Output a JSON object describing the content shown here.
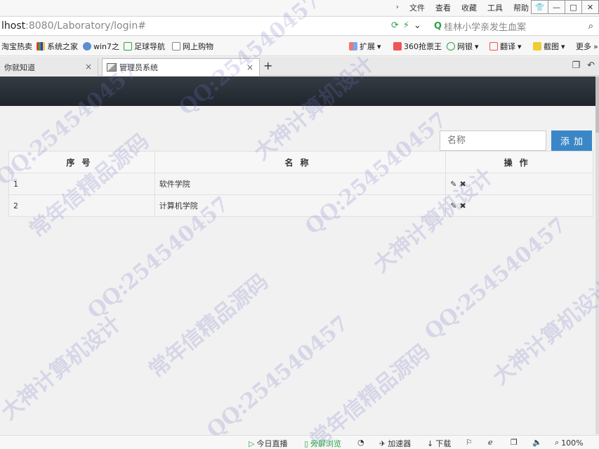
{
  "titlebar": {
    "menu": [
      "文件",
      "查看",
      "收藏",
      "工具",
      "帮助"
    ]
  },
  "address": {
    "host": "lhost",
    "rest": ":8080/Laboratory/login#",
    "search_text": "桂林小学亲发生血案"
  },
  "bookmarks": [
    {
      "label": "淘宝热卖",
      "icon": "taobao-icon"
    },
    {
      "label": "系统之家",
      "icon": "windows-icon"
    },
    {
      "label": "win7之",
      "icon": "cloud-icon"
    },
    {
      "label": "足球导航",
      "icon": "football-icon"
    },
    {
      "label": "网上购物",
      "icon": "page-icon"
    }
  ],
  "bookmarks_right": [
    {
      "label": "扩展",
      "icon": "grid-icon"
    },
    {
      "label": "360抢票王",
      "icon": "ticket-icon"
    },
    {
      "label": "网银",
      "icon": "bank-icon"
    },
    {
      "label": "翻译",
      "icon": "translate-icon"
    },
    {
      "label": "截图",
      "icon": "scissors-icon"
    },
    {
      "label": "更多",
      "icon": "more-icon"
    }
  ],
  "tabs": [
    {
      "label": "你就知道",
      "active": false
    },
    {
      "label": "管理员系统",
      "active": true
    }
  ],
  "form": {
    "name_placeholder": "名称",
    "add_label": "添加"
  },
  "table": {
    "headers": [
      "序号",
      "名称",
      "操作"
    ],
    "rows": [
      {
        "id": "1",
        "name": "软件学院"
      },
      {
        "id": "2",
        "name": "计算机学院"
      }
    ]
  },
  "statusbar": {
    "items": [
      "今日直播",
      "旁屏浏览",
      "加速器",
      "下载"
    ],
    "zoom": "100%"
  },
  "watermarks": [
    "QQ:254540457",
    "常年信精品源码",
    "大神计算机设计"
  ]
}
